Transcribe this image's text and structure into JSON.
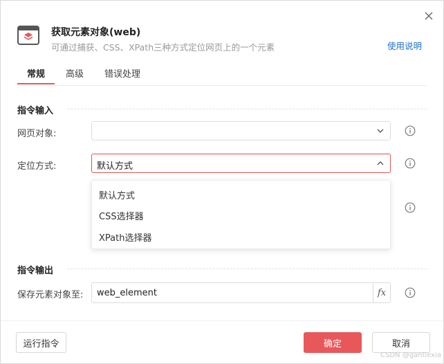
{
  "dialog": {
    "title": "获取元素对象(web)",
    "subtitle": "可通过捕获、CSS、XPath三种方式定位网页上的一个元素",
    "help_link": "使用说明",
    "close_icon": "close-icon"
  },
  "tabs": [
    {
      "label": "常规",
      "active": true
    },
    {
      "label": "高级",
      "active": false
    },
    {
      "label": "错误处理",
      "active": false
    }
  ],
  "input_section": {
    "title": "指令输入",
    "web_object": {
      "label": "网页对象:",
      "value": ""
    },
    "locate_method": {
      "label": "定位方式:",
      "value": "默认方式",
      "options": [
        "默认方式",
        "CSS选择器",
        "XPath选择器"
      ]
    }
  },
  "output_section": {
    "title": "指令输出",
    "save_to": {
      "label": "保存元素对象至:",
      "value": "web_element",
      "fx_label": "fx"
    }
  },
  "footer": {
    "run_label": "运行指令",
    "ok_label": "确定",
    "cancel_label": "取消"
  },
  "watermark": "CSDN @gantiexia",
  "colors": {
    "accent": "#e8585a",
    "link": "#1a6fd0",
    "focus_border": "#d9534f"
  }
}
